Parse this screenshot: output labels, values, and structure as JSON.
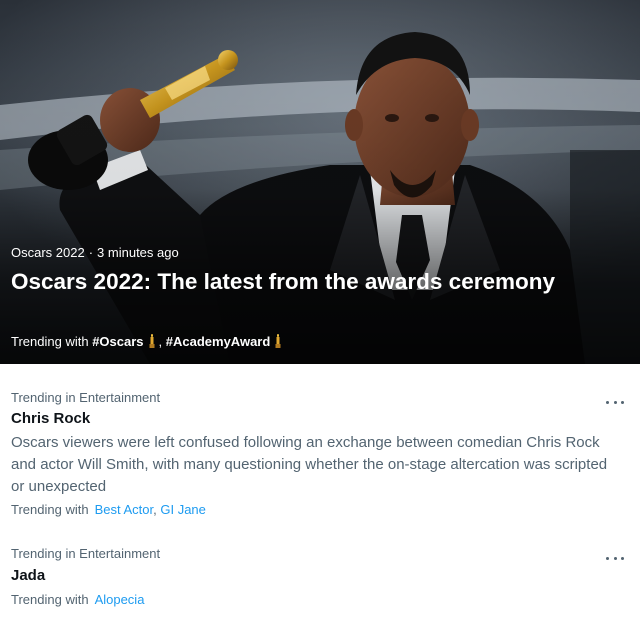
{
  "hero": {
    "category": "Oscars 2022",
    "separator": "·",
    "time_ago": "3 minutes ago",
    "title": "Oscars 2022: The latest from the awards ceremony",
    "trending_label": "Trending with",
    "tags": [
      "#Oscars",
      "#AcademyAward"
    ],
    "tag_separator": ","
  },
  "trends": [
    {
      "context": "Trending in Entertainment",
      "name": "Chris Rock",
      "description": "Oscars viewers were left confused following an exchange between comedian Chris Rock and actor Will Smith, with many questioning whether the on-stage altercation was scripted or unexpected",
      "trending_label": "Trending with",
      "related": [
        "Best Actor",
        "GI Jane"
      ],
      "related_separator": ","
    },
    {
      "context": "Trending in Entertainment",
      "name": "Jada",
      "trending_label": "Trending with",
      "related": [
        "Alopecia"
      ]
    }
  ],
  "icons": {
    "more": "more-horizontal-icon",
    "trophy": "oscar-statuette-icon"
  },
  "colors": {
    "link": "#1d9bf0",
    "secondary_text": "#536471",
    "primary_text": "#0f1419"
  }
}
